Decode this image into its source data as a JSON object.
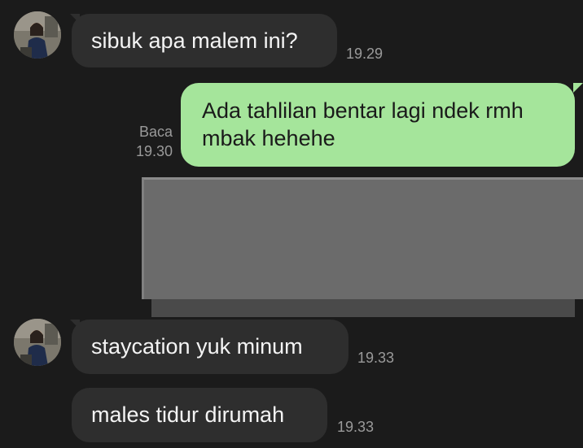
{
  "messages": [
    {
      "sender": "contact",
      "text": "sibuk apa malem ini?",
      "time": "19.29"
    },
    {
      "sender": "me",
      "text": "Ada tahlilan bentar lagi ndek rmh mbak hehehe",
      "status": "Baca",
      "time": "19.30"
    },
    {
      "sender": "contact",
      "text": "staycation yuk minum",
      "time": "19.33"
    },
    {
      "sender": "contact",
      "text": "males tidur dirumah",
      "time": "19.33"
    }
  ],
  "colors": {
    "background": "#1b1b1b",
    "incoming_bubble": "#2e2e2e",
    "outgoing_bubble": "#a5e59b",
    "timestamp": "#9a9a9a"
  },
  "icons": {
    "avatar": "contact-avatar-photo"
  }
}
